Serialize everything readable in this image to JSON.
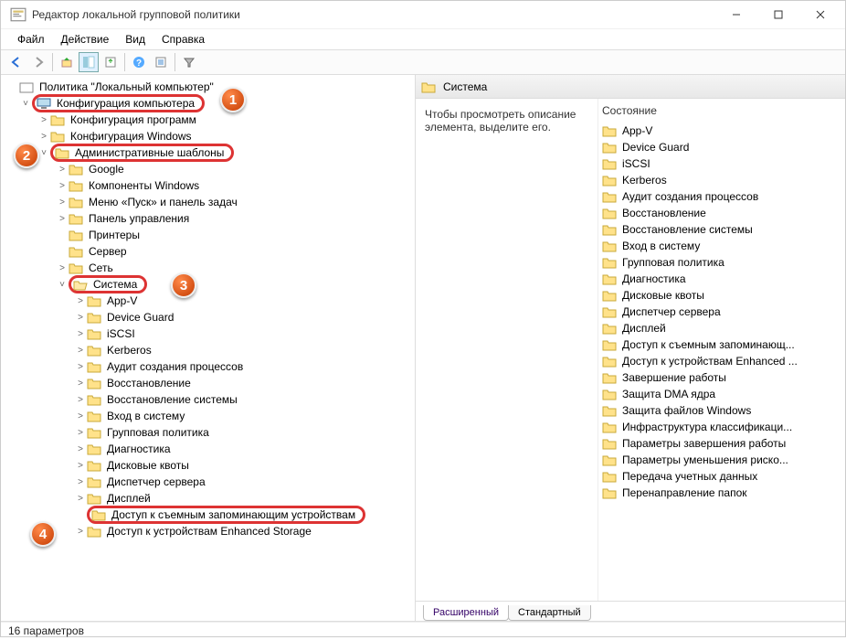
{
  "window": {
    "title": "Редактор локальной групповой политики"
  },
  "menu": {
    "file": "Файл",
    "action": "Действие",
    "view": "Вид",
    "help": "Справка"
  },
  "tree": {
    "root": "Политика \"Локальный компьютер\"",
    "cfg_comp": "Конфигурация компьютера",
    "cfg_prog": "Конфигурация программ",
    "cfg_win": "Конфигурация Windows",
    "admin_tmpl": "Административные шаблоны",
    "google": "Google",
    "comp_win": "Компоненты Windows",
    "startmenu": "Меню «Пуск» и панель задач",
    "cpanel": "Панель управления",
    "printers": "Принтеры",
    "server": "Сервер",
    "net": "Сеть",
    "system": "Система",
    "sys_children": [
      "App-V",
      "Device Guard",
      "iSCSI",
      "Kerberos",
      "Аудит создания процессов",
      "Восстановление",
      "Восстановление системы",
      "Вход в систему",
      "Групповая политика",
      "Диагностика",
      "Дисковые квоты",
      "Диспетчер сервера",
      "Дисплей",
      "Доступ к съемным запоминающим устройствам",
      "Доступ к устройствам Enhanced Storage"
    ]
  },
  "list": {
    "header_title": "Система",
    "desc_hint": "Чтобы просмотреть описание элемента, выделите его.",
    "state_header": "Состояние",
    "items": [
      "App-V",
      "Device Guard",
      "iSCSI",
      "Kerberos",
      "Аудит создания процессов",
      "Восстановление",
      "Восстановление системы",
      "Вход в систему",
      "Групповая политика",
      "Диагностика",
      "Дисковые квоты",
      "Диспетчер сервера",
      "Дисплей",
      "Доступ к съемным запоминающ...",
      "Доступ к устройствам Enhanced ...",
      "Завершение работы",
      "Защита DMA ядра",
      "Защита файлов Windows",
      "Инфраструктура классификаци...",
      "Параметры завершения работы",
      "Параметры уменьшения риско...",
      "Передача учетных данных",
      "Перенаправление папок"
    ]
  },
  "tabs": {
    "ext": "Расширенный",
    "std": "Стандартный"
  },
  "status": "16 параметров",
  "steps": {
    "s1": "1",
    "s2": "2",
    "s3": "3",
    "s4": "4"
  }
}
